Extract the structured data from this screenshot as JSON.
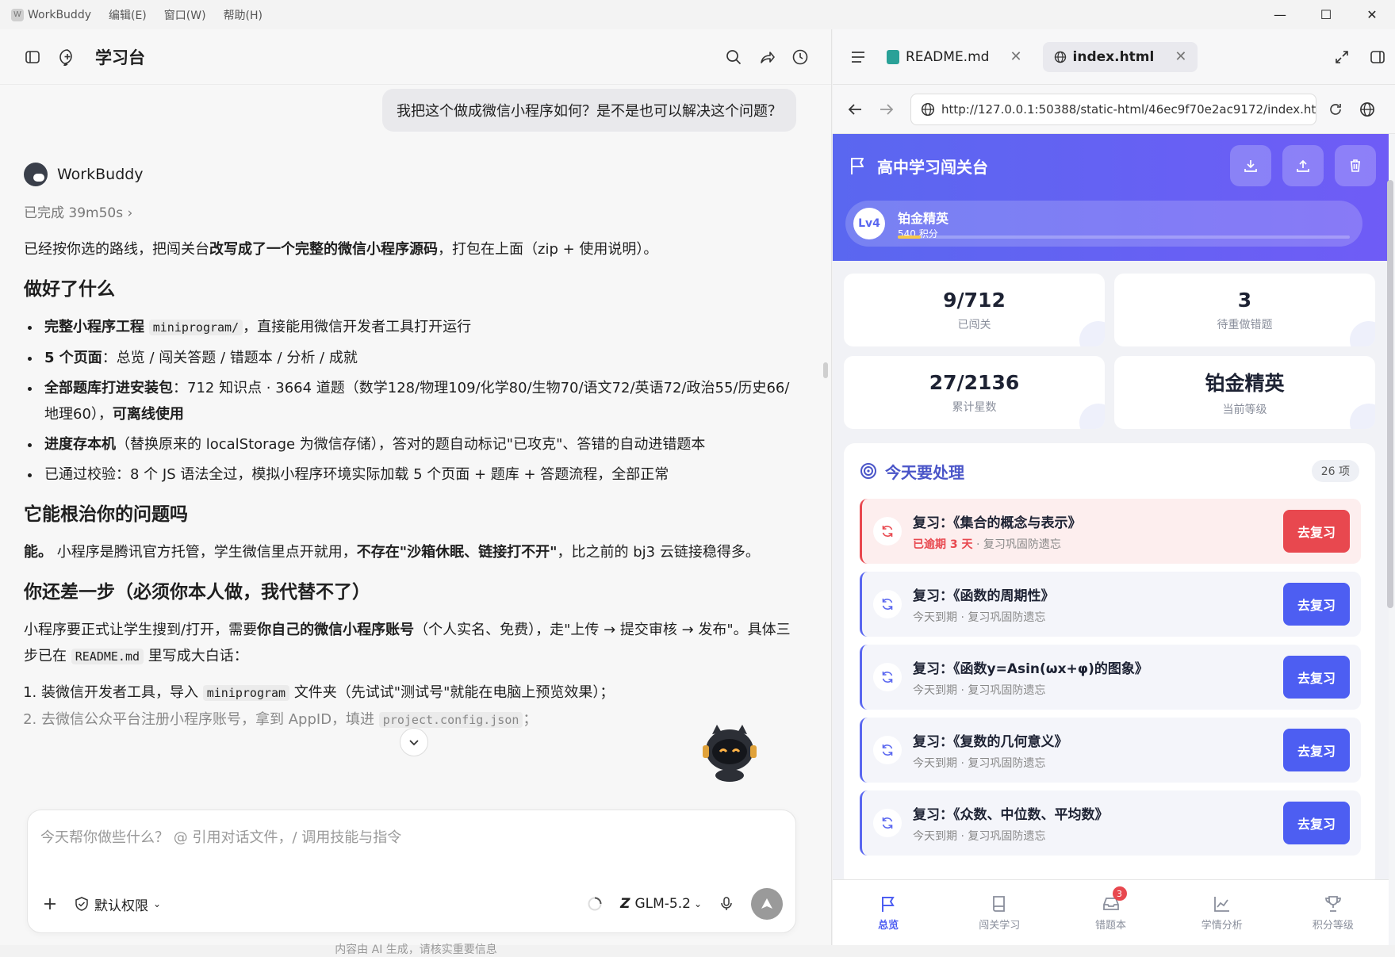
{
  "titlebar": {
    "app": "WorkBuddy",
    "menus": [
      "编辑(E)",
      "窗口(W)",
      "帮助(H)"
    ]
  },
  "left": {
    "title": "学习台",
    "user_message": "我把这个做成微信小程序如何？是不是也可以解决这个问题？",
    "bot_name": "WorkBuddy",
    "status": "已完成 39m50s",
    "intro_a": "已经按你选的路线，把闯关台",
    "intro_b": "改写成了一个完整的微信小程序源码",
    "intro_c": "，打包在上面（zip + 使用说明）。",
    "h1": "做好了什么",
    "b1_bold": "完整小程序工程",
    "b1_code": "miniprogram/",
    "b1_rest": "，直接能用微信开发者工具打开运行",
    "b2_bold": "5 个页面",
    "b2_rest": "：总览 / 闯关答题 / 错题本 / 分析 / 成就",
    "b3_bold": "全部题库打进安装包",
    "b3_rest": "：712 知识点 · 3664 道题（数学128/物理109/化学80/生物70/语文72/英语72/政治55/历史66/地理60），",
    "b3_bold2": "可离线使用",
    "b4_bold": "进度存本机",
    "b4_rest": "（替换原来的 localStorage 为微信存储），答对的题自动标记\"已攻克\"、答错的自动进错题本",
    "b5": "已通过校验：8 个 JS 语法全过，模拟小程序环境实际加载 5 个页面 + 题库 + 答题流程，全部正常",
    "h2": "它能根治你的问题吗",
    "p2_a": "能。",
    "p2_b": "小程序是腾讯官方托管，学生微信里点开就用，",
    "p2_c": "不存在\"沙箱休眠、链接打不开\"",
    "p2_d": "，比之前的 bj3 云链接稳得多。",
    "h3": "你还差一步（必须你本人做，我代替不了）",
    "p3_a": "小程序要正式让学生搜到/打开，需要",
    "p3_b": "你自己的微信小程序账号",
    "p3_c": "（个人实名、免费），走\"上传 → 提交审核 → 发布\"。具体三步已在",
    "p3_code": "README.md",
    "p3_d": "里写成大白话：",
    "s1_a": "装微信开发者工具，导入",
    "s1_code": "miniprogram",
    "s1_b": "文件夹（先试试\"测试号\"就能在电脑上预览效果）；",
    "s2_a": "去微信公众平台注册小程序账号，拿到 AppID，填进",
    "s2_code": "project.config.json",
    "s2_b": "；",
    "input_placeholder": "今天帮你做些什么？ @ 引用对话文件，/ 调用技能与指令",
    "permission": "默认权限",
    "model": "GLM-5.2",
    "disclaimer": "内容由 AI 生成，请核实重要信息"
  },
  "right": {
    "tabs": [
      {
        "label": "README.md"
      },
      {
        "label": "index.html"
      }
    ],
    "url": "http://127.0.0.1:50388/static-html/46ec9f70e2ac9172/index.ht",
    "app_title": "高中学习闯关台",
    "level_badge": "Lv4",
    "level_name": "铂金精英",
    "points": "540 积分",
    "level_progress": 0.05,
    "stats": [
      {
        "value": "9/712",
        "label": "已闯关"
      },
      {
        "value": "3",
        "label": "待重做错题"
      },
      {
        "value": "27/2136",
        "label": "累计星数"
      },
      {
        "value": "铂金精英",
        "label": "当前等级"
      }
    ],
    "today_title": "今天要处理",
    "today_count": "26 项",
    "tasks": [
      {
        "title": "复习：《集合的概念与表示》",
        "due": "已逾期 3 天",
        "note": " · 复习巩固防遗忘",
        "button": "去复习"
      },
      {
        "title": "复习：《函数的周期性》",
        "due": "今天到期",
        "note": " · 复习巩固防遗忘",
        "button": "去复习"
      },
      {
        "title": "复习：《函数y=Asin(ωx+φ)的图象》",
        "due": "今天到期",
        "note": " · 复习巩固防遗忘",
        "button": "去复习"
      },
      {
        "title": "复习：《复数的几何意义》",
        "due": "今天到期",
        "note": " · 复习巩固防遗忘",
        "button": "去复习"
      },
      {
        "title": "复习：《众数、中位数、平均数》",
        "due": "今天到期",
        "note": " · 复习巩固防遗忘",
        "button": "去复习"
      }
    ],
    "nav": [
      {
        "label": "总览"
      },
      {
        "label": "闯关学习"
      },
      {
        "label": "错题本",
        "badge": "3"
      },
      {
        "label": "学情分析"
      },
      {
        "label": "积分等级"
      }
    ]
  },
  "colors": {
    "accent": "#5a67f0",
    "danger": "#e8484f",
    "gold": "#f7c948"
  }
}
